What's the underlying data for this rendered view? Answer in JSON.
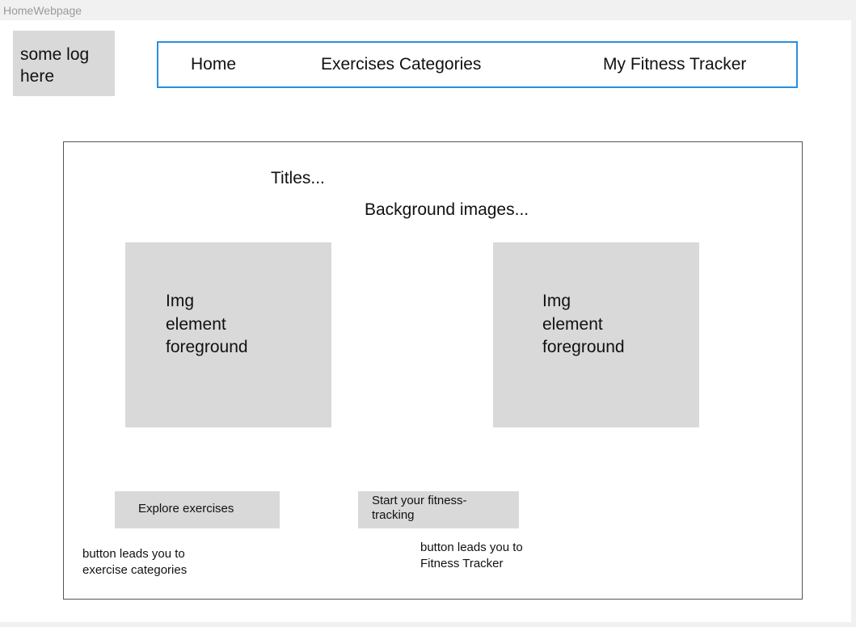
{
  "frame_label": "HomeWebpage",
  "logo": {
    "line1": "some log",
    "line2": "here"
  },
  "nav": {
    "items": [
      {
        "label": "Home"
      },
      {
        "label": "Exercises Categories"
      },
      {
        "label": "My Fitness Tracker"
      }
    ]
  },
  "main": {
    "titles": "Titles...",
    "background_images": "Background images...",
    "img_left": {
      "line1": "Img",
      "line2": "element",
      "line3": "foreground"
    },
    "img_right": {
      "line1": "Img",
      "line2": "element",
      "line3": "foreground"
    },
    "explore_button": "Explore exercises",
    "tracker_button": {
      "line1": "Start your fitness-",
      "line2": "tracking"
    },
    "note_left": {
      "line1": "button leads you to",
      "line2": "exercise categories"
    },
    "note_right": {
      "line1": "button leads you to",
      "line2": "Fitness Tracker"
    }
  },
  "colors": {
    "nav_border": "#2a8ee0",
    "placeholder_fill": "#d9d9d9",
    "canvas_background": "#f1f1f1"
  }
}
